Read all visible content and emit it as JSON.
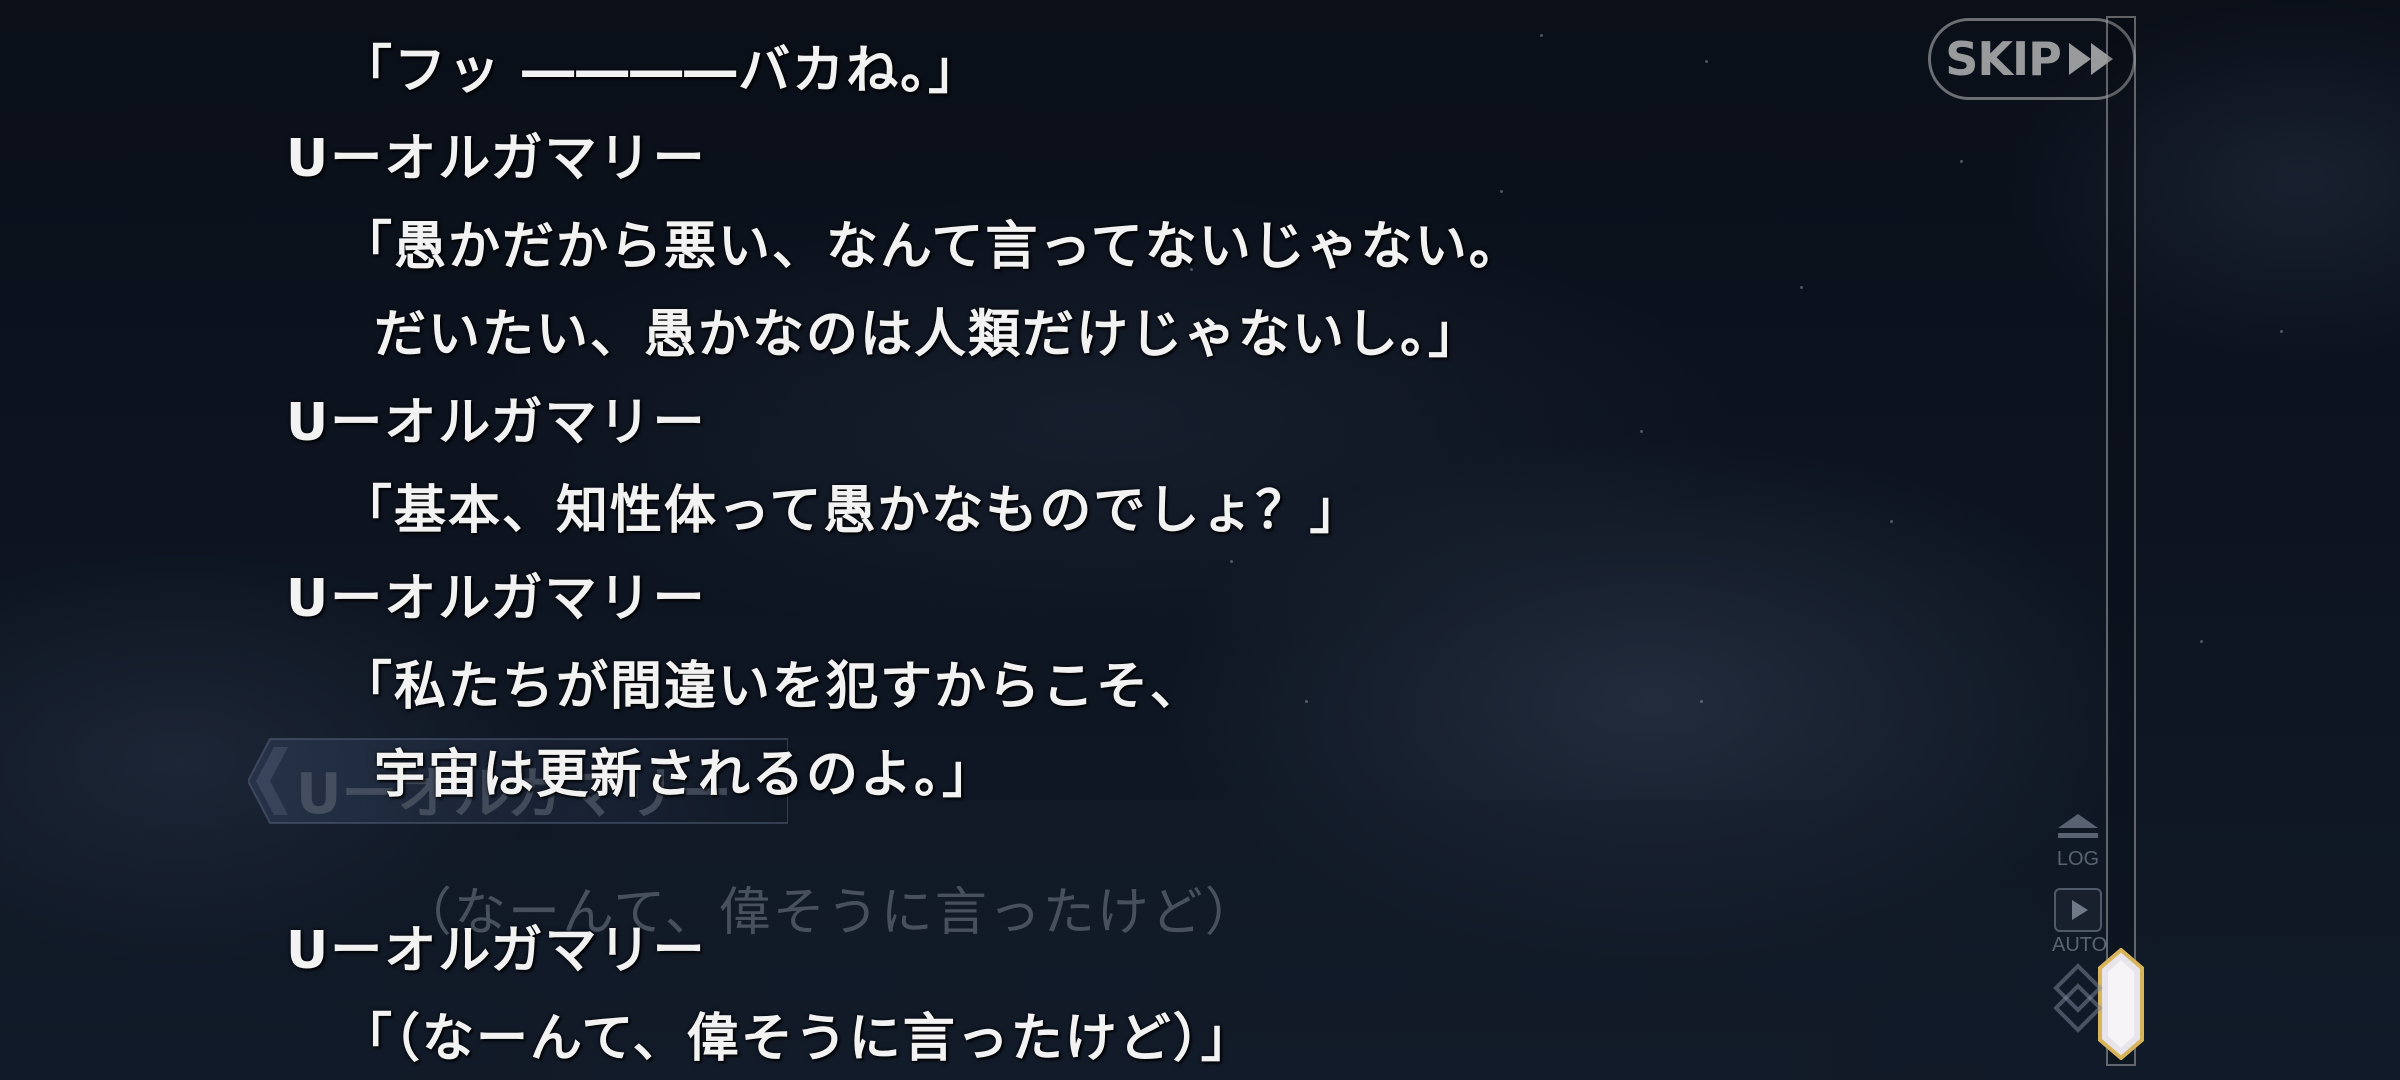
{
  "skip_button": {
    "label": "SKIP"
  },
  "controls": {
    "log_label": "LOG",
    "auto_label": "AUTO"
  },
  "background_dialog": {
    "speaker": "Uーオルガマリー",
    "text": "（なーんて、偉そうに言ったけど）"
  },
  "log": [
    {
      "type": "text",
      "text": "「フッ ――――バカね。」"
    },
    {
      "type": "speaker",
      "text": "Uーオルガマリー"
    },
    {
      "type": "text",
      "text": "「愚かだから悪い、なんて言ってないじゃない。"
    },
    {
      "type": "text",
      "text": "だいたい、愚かなのは人類だけじゃないし。」"
    },
    {
      "type": "speaker",
      "text": "Uーオルガマリー"
    },
    {
      "type": "text",
      "text": "「基本、知性体って愚かなものでしょ？」"
    },
    {
      "type": "speaker",
      "text": "Uーオルガマリー"
    },
    {
      "type": "text",
      "text": "「私たちが間違いを犯すからこそ、"
    },
    {
      "type": "text",
      "text": "宇宙は更新されるのよ。」"
    },
    {
      "type": "speaker",
      "text": "Uーオルガマリー"
    },
    {
      "type": "text",
      "text": "「（なーんて、偉そうに言ったけど）」"
    }
  ],
  "scroll": {
    "position": 1.0
  },
  "colors": {
    "text": "#f2f2f2",
    "thumb_gold": "#d8b45a",
    "thumb_fill": "#e8e4ec"
  },
  "icons": {
    "skip": "double-chevron-right",
    "log": "eject-triangle",
    "auto": "play-triangle",
    "menu": "diamond-stack"
  }
}
